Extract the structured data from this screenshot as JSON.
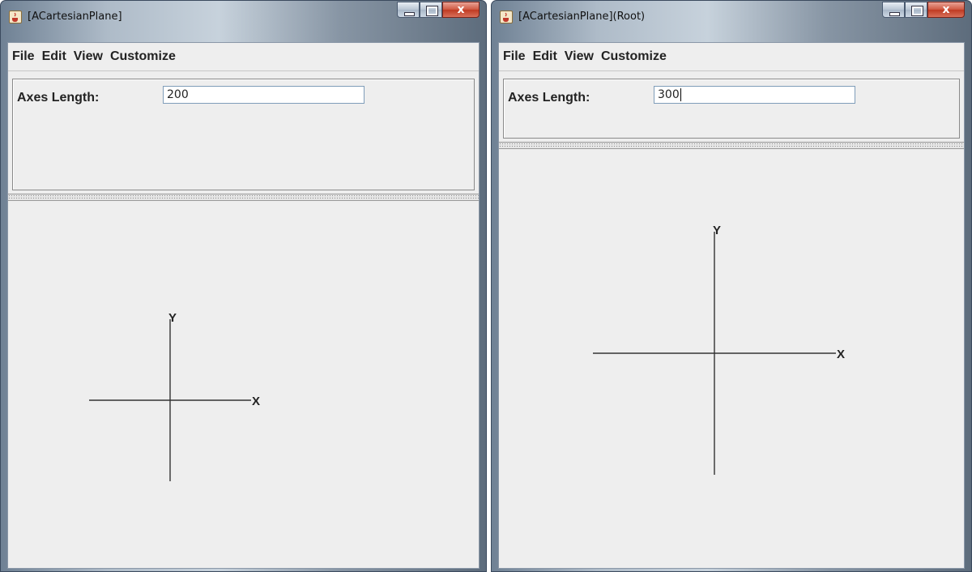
{
  "windows": [
    {
      "title": "[ACartesianPlane]",
      "menu": [
        "File",
        "Edit",
        "View",
        "Customize"
      ],
      "axes_label": "Axes Length:",
      "axes_value": "200",
      "x_axis_label": "X",
      "y_axis_label": "Y",
      "axes_length": 200
    },
    {
      "title": "[ACartesianPlane](Root)",
      "menu": [
        "File",
        "Edit",
        "View",
        "Customize"
      ],
      "axes_label": "Axes Length:",
      "axes_value": "300",
      "x_axis_label": "X",
      "y_axis_label": "Y",
      "axes_length": 300
    }
  ],
  "colors": {
    "window_bg": "#eeeeee",
    "axis_line": "#333333",
    "close_button": "#c9462e"
  }
}
